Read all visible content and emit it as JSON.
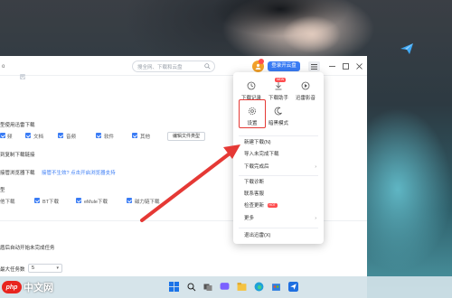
{
  "titlebar": {
    "left_fragment": "o",
    "search_placeholder": "搜全网、下载和云盘",
    "vip_label": "登录开云盘",
    "avatar_label": "!"
  },
  "content": {
    "line1": "型使用迅雷下载",
    "checkboxes_row1": [
      "频",
      "文档",
      "音频",
      "软件",
      "其他"
    ],
    "edit_types_label": "编辑文件类型",
    "line2": "到复制下载链接",
    "line3": "接管浏览器下载",
    "line3_link": "接管不生效? 点击开启浏览器支持",
    "line4": "型",
    "checkboxes_row2": [
      "他下载",
      "BT下载",
      "eMule下载",
      "磁力链下载"
    ],
    "line5": "盾后自动开始未完成任务",
    "line6": "最大任务数",
    "max_tasks_value": "5"
  },
  "dropdown": {
    "grid_top": [
      {
        "label": "下载记录",
        "icon": "history-icon"
      },
      {
        "label": "下载助手",
        "icon": "download-assistant-icon",
        "badge": "NEW"
      },
      {
        "label": "迅雷影音",
        "icon": "video-player-icon"
      }
    ],
    "grid_bottom": [
      {
        "label": "设置",
        "icon": "gear-icon"
      },
      {
        "label": "暗黑模式",
        "icon": "moon-icon"
      }
    ],
    "items": [
      {
        "label": "新建下载(N)"
      },
      {
        "label": "导入未完成下载"
      },
      {
        "label": "下载完成后",
        "submenu": true
      },
      {
        "label": "下载诊断"
      },
      {
        "label": "联系客服"
      },
      {
        "label": "检查更新",
        "hot": "HOT"
      },
      {
        "label": "更多",
        "submenu": true
      },
      {
        "label": "退出迅雷(X)"
      }
    ]
  },
  "watermark": {
    "logo": "php",
    "cn_text": "中文网",
    "url": ""
  },
  "colors": {
    "accent": "#3a7cf5",
    "highlight": "#e53935",
    "badge": "#ff4d4f"
  }
}
